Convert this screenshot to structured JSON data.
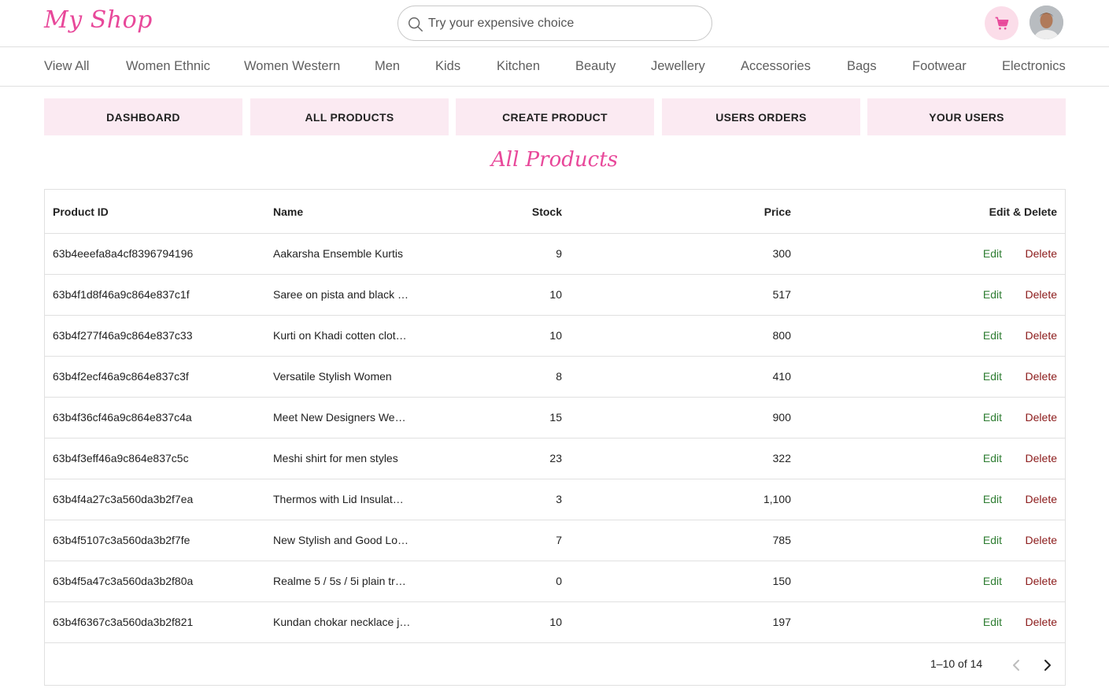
{
  "header": {
    "logo": "My Shop",
    "search_placeholder": "Try your expensive choice",
    "accent_color": "#e8489a"
  },
  "icons": {
    "search": "search-icon",
    "cart": "cart-icon",
    "avatar": "user-avatar",
    "prev": "chevron-left-icon",
    "next": "chevron-right-icon"
  },
  "categories": [
    "View All",
    "Women Ethnic",
    "Women Western",
    "Men",
    "Kids",
    "Kitchen",
    "Beauty",
    "Jewellery",
    "Accessories",
    "Bags",
    "Footwear",
    "Electronics"
  ],
  "tabs": [
    "DASHBOARD",
    "ALL PRODUCTS",
    "CREATE PRODUCT",
    "USERS ORDERS",
    "YOUR USERS"
  ],
  "page_title": "All Products",
  "table": {
    "columns": [
      "Product ID",
      "Name",
      "Stock",
      "Price",
      "Edit & Delete"
    ],
    "edit_label": "Edit",
    "delete_label": "Delete",
    "rows": [
      {
        "id": "63b4eeefa8a4cf8396794196",
        "name": "Aakarsha Ensemble Kurtis",
        "stock": "9",
        "price": "300"
      },
      {
        "id": "63b4f1d8f46a9c864e837c1f",
        "name": "Saree on pista and black …",
        "stock": "10",
        "price": "517"
      },
      {
        "id": "63b4f277f46a9c864e837c33",
        "name": "Kurti on Khadi cotten clot…",
        "stock": "10",
        "price": "800"
      },
      {
        "id": "63b4f2ecf46a9c864e837c3f",
        "name": "Versatile Stylish Women",
        "stock": "8",
        "price": "410"
      },
      {
        "id": "63b4f36cf46a9c864e837c4a",
        "name": "Meet New Designers Wed…",
        "stock": "15",
        "price": "900"
      },
      {
        "id": "63b4f3eff46a9c864e837c5c",
        "name": "Meshi shirt for men styles",
        "stock": "23",
        "price": "322"
      },
      {
        "id": "63b4f4a27c3a560da3b2f7ea",
        "name": "Thermos with Lid Insulat…",
        "stock": "3",
        "price": "1,100"
      },
      {
        "id": "63b4f5107c3a560da3b2f7fe",
        "name": "New Stylish and Good Lo…",
        "stock": "7",
        "price": "785"
      },
      {
        "id": "63b4f5a47c3a560da3b2f80a",
        "name": "Realme 5 / 5s / 5i plain tr…",
        "stock": "0",
        "price": "150"
      },
      {
        "id": "63b4f6367c3a560da3b2f821",
        "name": "Kundan chokar necklace j…",
        "stock": "10",
        "price": "197"
      }
    ]
  },
  "pagination": {
    "range_label": "1–10 of 14"
  }
}
